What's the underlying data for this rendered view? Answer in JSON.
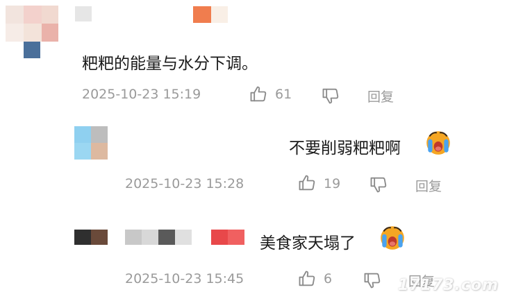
{
  "comments": [
    {
      "text": "粑粑的能量与水分下调。",
      "time": "2025-10-23 15:19",
      "likes": "61",
      "reply_label": "回复"
    },
    {
      "text": "不要削弱粑粑啊",
      "time": "2025-10-23 15:28",
      "likes": "19",
      "reply_label": "回复"
    },
    {
      "text": "美食家天塌了",
      "time": "2025-10-23 15:45",
      "likes": "6",
      "reply_label": "回复"
    }
  ],
  "watermark": "17173.com",
  "colors": {
    "meta_text": "#9a9a9a",
    "emoji_face": "#f5a623",
    "emoji_tears": "#4aa3f0"
  }
}
